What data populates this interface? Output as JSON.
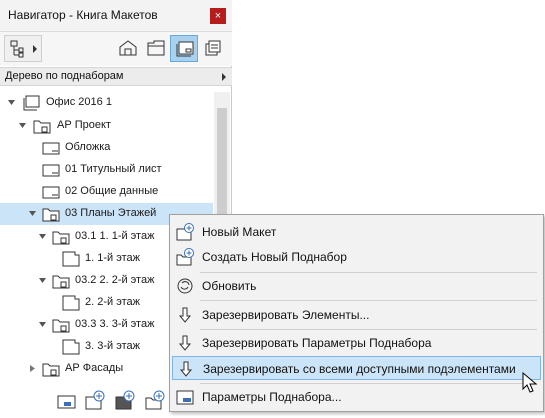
{
  "window": {
    "title": "Навигатор - Книга Макетов",
    "close_icon": "×"
  },
  "set_selector": {
    "label": "Дерево по поднаборам"
  },
  "tree": {
    "rows": [
      {
        "label": "Офис 2016 1"
      },
      {
        "label": "АР Проект"
      },
      {
        "label": "Обложка"
      },
      {
        "label": "01 Титульный лист"
      },
      {
        "label": "02 Общие данные"
      },
      {
        "label": "03 Планы Этажей"
      },
      {
        "label": "03.1 1. 1-й этаж"
      },
      {
        "label": "1. 1-й этаж"
      },
      {
        "label": "03.2 2. 2-й этаж"
      },
      {
        "label": "2. 2-й этаж"
      },
      {
        "label": "03.3 3. 3-й этаж"
      },
      {
        "label": "3. 3-й этаж"
      },
      {
        "label": "АР Фасады"
      }
    ]
  },
  "context_menu": {
    "items": [
      {
        "label": "Новый Макет"
      },
      {
        "label": "Создать Новый Поднабор"
      },
      {
        "label": "Обновить"
      },
      {
        "label": "Зарезервировать Элементы..."
      },
      {
        "label": "Зарезервировать Параметры Поднабора"
      },
      {
        "label": "Зарезервировать со всеми доступными подэлементами"
      },
      {
        "label": "Параметры Поднабора..."
      }
    ]
  },
  "colors": {
    "selection": "#cce4f7",
    "close_button": "#b71c1c",
    "active_tool": "#a8d1f0"
  }
}
